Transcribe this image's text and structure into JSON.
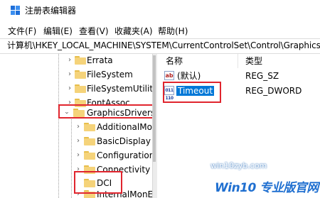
{
  "window": {
    "title": "注册表编辑器",
    "icon": "registry-editor-icon"
  },
  "menu": [
    "文件(F)",
    "编辑(E)",
    "查看(V)",
    "收藏夹(A)",
    "帮助(H)"
  ],
  "address": "计算机\\HKEY_LOCAL_MACHINE\\SYSTEM\\CurrentControlSet\\Control\\GraphicsDrive",
  "tree": {
    "items": [
      {
        "label": "Errata",
        "expanded": false
      },
      {
        "label": "FileSystem",
        "expanded": false
      },
      {
        "label": "FileSystemUtiliti",
        "expanded": false
      },
      {
        "label": "FontAssoc",
        "expanded": false
      },
      {
        "label": "GraphicsDrivers",
        "expanded": true,
        "highlighted": true
      },
      {
        "label": "AdditionalMo",
        "expanded": false
      },
      {
        "label": "BasicDisplay",
        "expanded": false
      },
      {
        "label": "Configuration",
        "expanded": false
      },
      {
        "label": "Connectivity",
        "expanded": false
      },
      {
        "label": "DCI",
        "expanded": false,
        "highlighted": true
      },
      {
        "label": "InternalMonE",
        "expanded": false
      }
    ]
  },
  "values": {
    "headers": {
      "name": "名称",
      "type": "类型"
    },
    "rows": [
      {
        "icon": "ab",
        "name": "(默认)",
        "type": "REG_SZ"
      },
      {
        "icon": "binary",
        "name": "Timeout",
        "type": "REG_DWORD",
        "selected": true,
        "highlighted": true
      }
    ]
  },
  "watermark": {
    "site": "win10zyb.com",
    "brand": "Win10 专业版官网"
  },
  "colors": {
    "highlight_box": "#e0252e",
    "selection": "#0078d7",
    "folder": "#f5d37a"
  }
}
